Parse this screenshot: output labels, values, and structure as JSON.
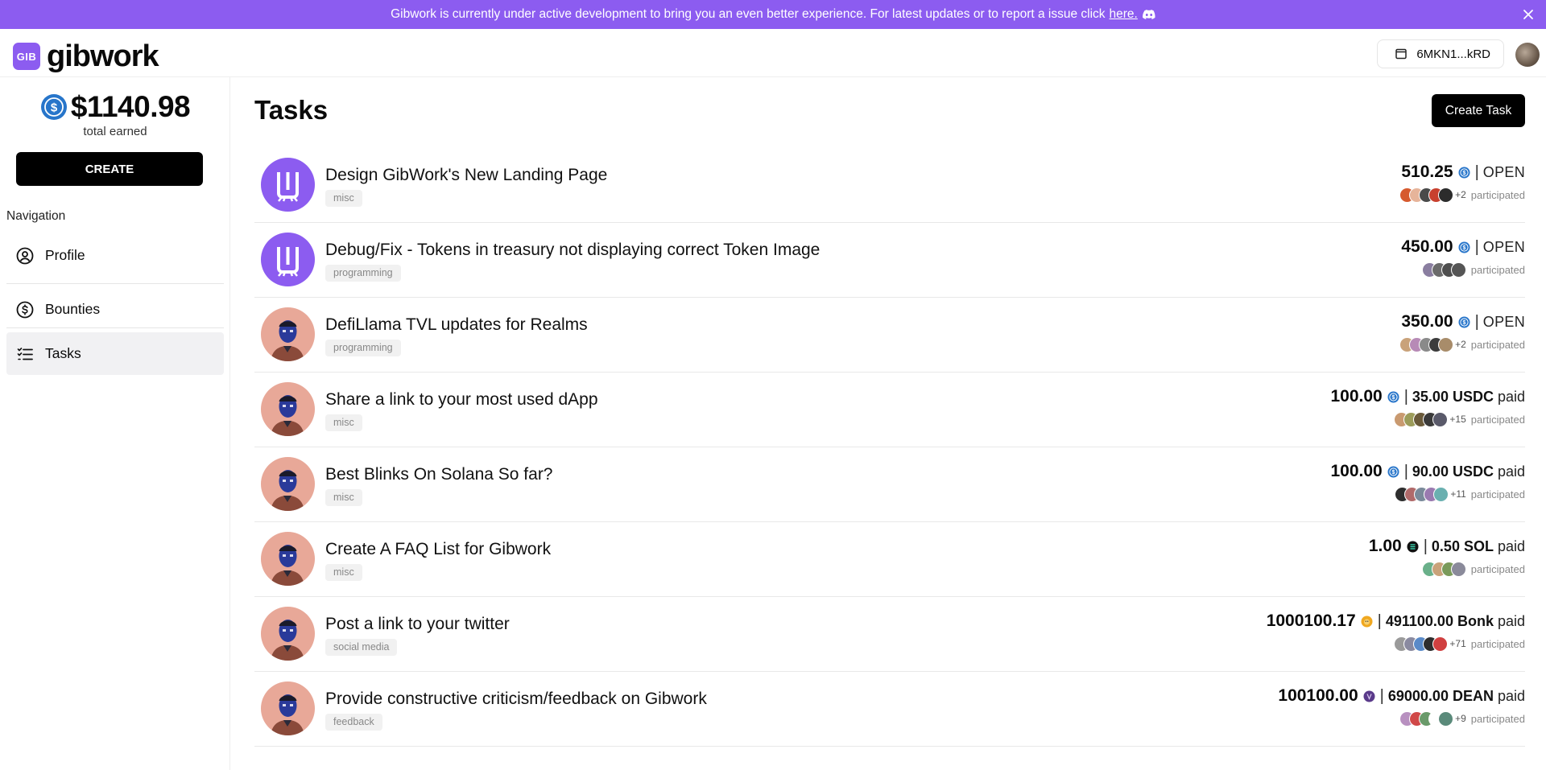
{
  "banner": {
    "text": "Gibwork is currently under active development to bring you an even better experience. For latest updates or to report a issue click",
    "link": "here."
  },
  "header": {
    "logo_badge": "GIB",
    "logo_text": "gibwork",
    "wallet": "6MKN1...kRD"
  },
  "sidebar": {
    "earned_amount": "$1140.98",
    "earned_label": "total earned",
    "create_label": "CREATE",
    "nav_heading": "Navigation",
    "items": [
      {
        "label": "Profile",
        "icon": "user-circle-icon"
      },
      {
        "label": "Bounties",
        "icon": "dollar-circle-icon"
      },
      {
        "label": "Tasks",
        "icon": "list-checks-icon"
      }
    ]
  },
  "main": {
    "title": "Tasks",
    "create_task_label": "Create Task",
    "participated_label": "participated",
    "tasks": [
      {
        "title": "Design GibWork's New Landing Page",
        "tag": "misc",
        "amount": "510.25",
        "token": "usdc",
        "status": "OPEN",
        "paid_value": "",
        "paid_word": "",
        "more": "+2",
        "avatar": "gibwork-logo",
        "parts": [
          "#d65a2e",
          "#e6b49a",
          "#4a4a4a",
          "#c8402e",
          "#2c2c2c"
        ]
      },
      {
        "title": "Debug/Fix - Tokens in treasury not displaying correct Token Image",
        "tag": "programming",
        "amount": "450.00",
        "token": "usdc",
        "status": "OPEN",
        "paid_value": "",
        "paid_word": "",
        "more": "",
        "avatar": "gibwork-logo",
        "parts": [
          "#8a7ea0",
          "#6b6b6b",
          "#4e4e4e",
          "#555555"
        ]
      },
      {
        "title": "DefiLlama TVL updates for Realms",
        "tag": "programming",
        "amount": "350.00",
        "token": "usdc",
        "status": "OPEN",
        "paid_value": "",
        "paid_word": "",
        "more": "+2",
        "avatar": "masked-person",
        "parts": [
          "#c9a27a",
          "#b78ab6",
          "#8a8a8a",
          "#3c3c3c",
          "#a88c6a"
        ]
      },
      {
        "title": "Share a link to your most used dApp",
        "tag": "misc",
        "amount": "100.00",
        "token": "usdc",
        "status": "",
        "paid_value": "35.00 USDC",
        "paid_word": "paid",
        "more": "+15",
        "avatar": "masked-person",
        "parts": [
          "#c99a70",
          "#9c9c5a",
          "#6a5a3a",
          "#3a3a3a",
          "#5a5a6a"
        ]
      },
      {
        "title": "Best Blinks On Solana So far?",
        "tag": "misc",
        "amount": "100.00",
        "token": "usdc",
        "status": "",
        "paid_value": "90.00 USDC",
        "paid_word": "paid",
        "more": "+11",
        "avatar": "masked-person",
        "parts": [
          "#2e2e2e",
          "#b06a6a",
          "#7a8a9a",
          "#9a7ab0",
          "#6ab0b0"
        ]
      },
      {
        "title": "Create A FAQ List for Gibwork",
        "tag": "misc",
        "amount": "1.00",
        "token": "sol",
        "status": "",
        "paid_value": "0.50 SOL",
        "paid_word": "paid",
        "more": "",
        "avatar": "masked-person",
        "parts": [
          "#6ab08a",
          "#c9a27a",
          "#7a9a5a",
          "#8a8a9a"
        ]
      },
      {
        "title": "Post a link to your twitter",
        "tag": "social media",
        "amount": "1000100.17",
        "token": "bonk",
        "status": "",
        "paid_value": "491100.00 Bonk",
        "paid_word": "paid",
        "more": "+71",
        "avatar": "masked-person",
        "parts": [
          "#9a9a9a",
          "#8a8aa0",
          "#5a8ac8",
          "#2e2e2e",
          "#d04040"
        ]
      },
      {
        "title": "Provide constructive criticism/feedback on Gibwork",
        "tag": "feedback",
        "amount": "100100.00",
        "token": "dean",
        "status": "",
        "paid_value": "69000.00 DEAN",
        "paid_word": "paid",
        "more": "+9",
        "avatar": "masked-person",
        "parts": [
          "#b890c0",
          "#d04848",
          "#6a9a6a",
          "#ffffff",
          "#5a8a7a"
        ]
      }
    ]
  },
  "colors": {
    "brand_purple": "#8c5cf0",
    "usdc_blue": "#2775ca",
    "bonk_orange": "#f0a820",
    "dean_purple": "#5a3a8a"
  }
}
